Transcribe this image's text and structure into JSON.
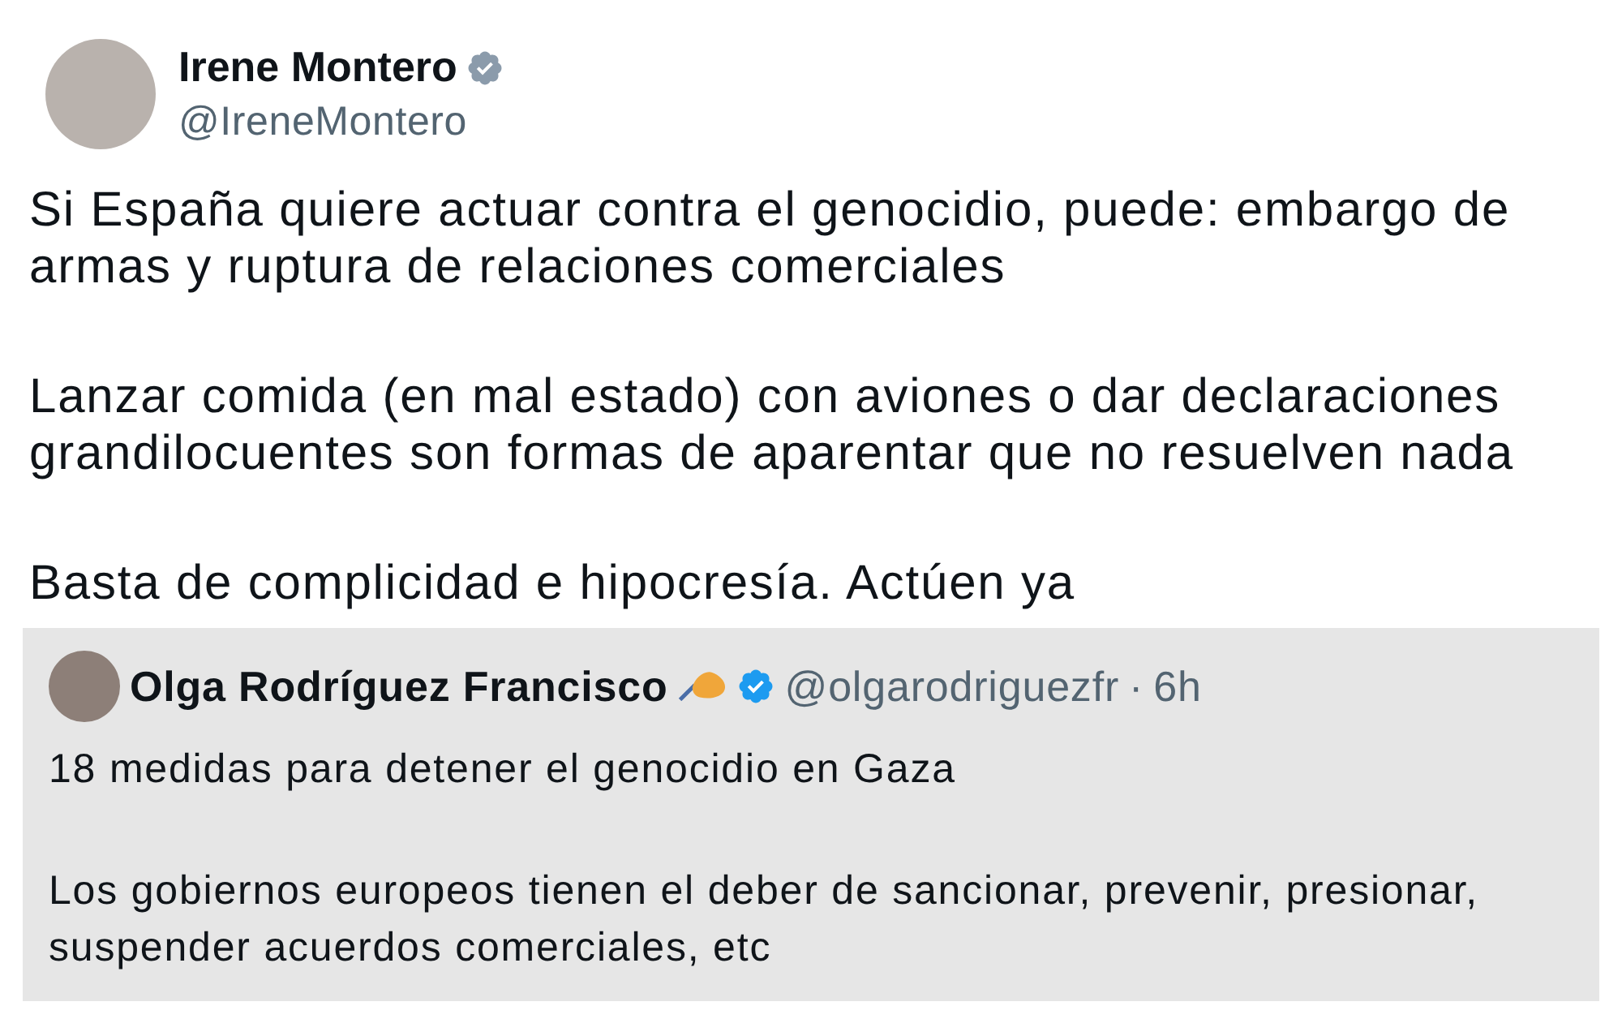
{
  "tweet": {
    "author": {
      "name": "Irene Montero",
      "handle": "@IreneMontero",
      "verified": true
    },
    "paragraphs": [
      "Si España quiere actuar contra el genocidio, puede: embargo de armas y ruptura de relaciones comerciales",
      "Lanzar comida (en mal estado) con aviones o dar declaraciones grandilocuentes son formas de aparentar que no resuelven nada",
      "Basta de complicidad e hipocresía. Actúen ya"
    ],
    "quoted": {
      "author": {
        "name": "Olga Rodríguez Francisco",
        "handle": "@olgarodriguezfr",
        "verified": true
      },
      "separator": "·",
      "time": "6h",
      "paragraphs": [
        "18 medidas para detener el genocidio en Gaza",
        "Los gobiernos europeos tienen el deber de sancionar, prevenir, presionar, suspender acuerdos comerciales, etc"
      ]
    }
  }
}
